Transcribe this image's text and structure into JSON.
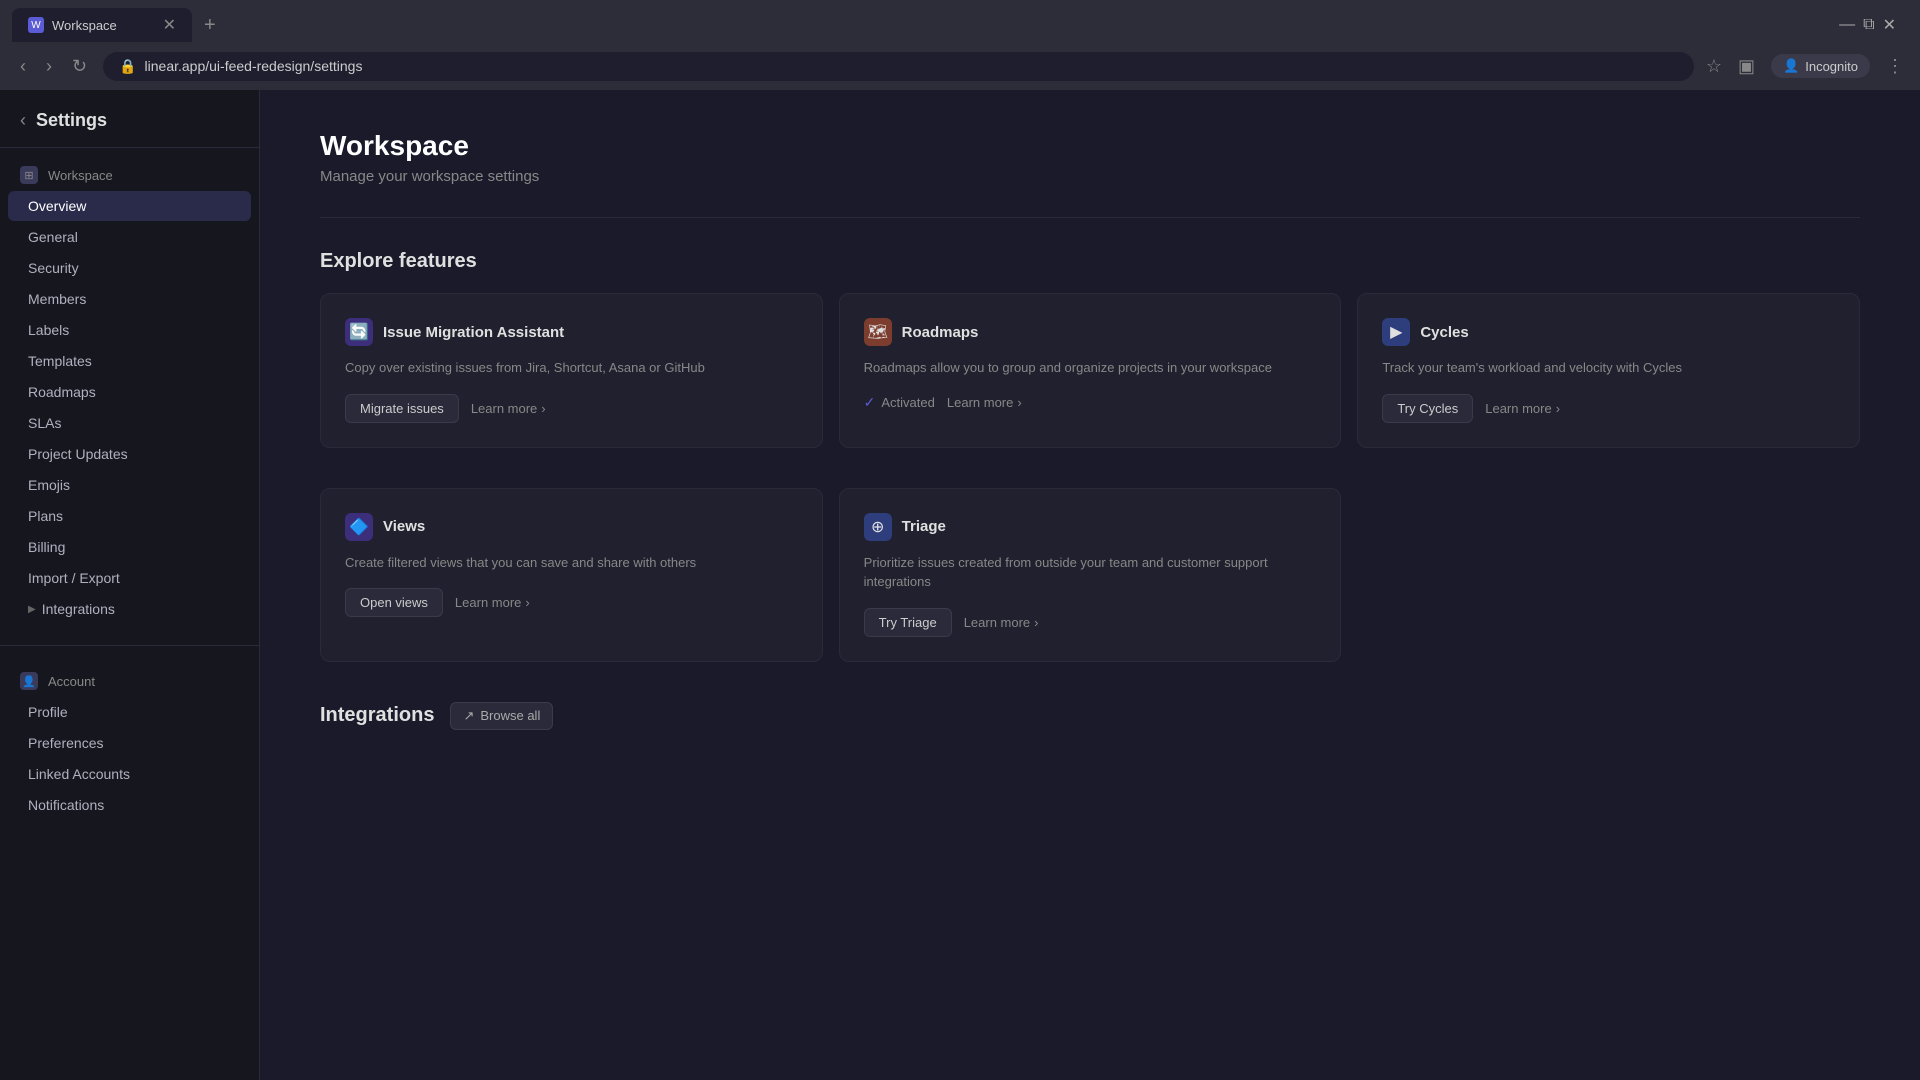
{
  "browser": {
    "tab_title": "Workspace",
    "tab_favicon": "W",
    "url": "linear.app/ui-feed-redesign/settings",
    "incognito_label": "Incognito"
  },
  "sidebar": {
    "title": "Settings",
    "back_label": "‹",
    "workspace_section": {
      "label": "Workspace",
      "items": [
        {
          "id": "overview",
          "label": "Overview",
          "active": true
        },
        {
          "id": "general",
          "label": "General",
          "active": false
        },
        {
          "id": "security",
          "label": "Security",
          "active": false
        },
        {
          "id": "members",
          "label": "Members",
          "active": false
        },
        {
          "id": "labels",
          "label": "Labels",
          "active": false
        },
        {
          "id": "templates",
          "label": "Templates",
          "active": false
        },
        {
          "id": "roadmaps",
          "label": "Roadmaps",
          "active": false
        },
        {
          "id": "slas",
          "label": "SLAs",
          "active": false
        },
        {
          "id": "project-updates",
          "label": "Project Updates",
          "active": false
        },
        {
          "id": "emojis",
          "label": "Emojis",
          "active": false
        },
        {
          "id": "plans",
          "label": "Plans",
          "active": false
        },
        {
          "id": "billing",
          "label": "Billing",
          "active": false
        },
        {
          "id": "import-export",
          "label": "Import / Export",
          "active": false
        },
        {
          "id": "integrations",
          "label": "Integrations",
          "active": false,
          "arrow": true
        }
      ]
    },
    "account_section": {
      "label": "Account",
      "items": [
        {
          "id": "profile",
          "label": "Profile",
          "active": false
        },
        {
          "id": "preferences",
          "label": "Preferences",
          "active": false
        },
        {
          "id": "linked-accounts",
          "label": "Linked Accounts",
          "active": false
        },
        {
          "id": "notifications",
          "label": "Notifications",
          "active": false
        }
      ]
    }
  },
  "page": {
    "title": "Workspace",
    "subtitle": "Manage your workspace settings",
    "explore_title": "Explore features",
    "integrations_title": "Integrations",
    "browse_all_label": "Browse all"
  },
  "features": [
    {
      "id": "issue-migration",
      "icon": "🔄",
      "icon_class": "purple",
      "name": "Issue Migration Assistant",
      "description": "Copy over existing issues from Jira, Shortcut, Asana or GitHub",
      "actions": [
        {
          "id": "migrate",
          "label": "Migrate issues",
          "type": "secondary"
        },
        {
          "id": "learn-more-migration",
          "label": "Learn more",
          "type": "link",
          "arrow": "›"
        }
      ]
    },
    {
      "id": "roadmaps",
      "icon": "🗺",
      "icon_class": "orange",
      "name": "Roadmaps",
      "description": "Roadmaps allow you to group and organize projects in your workspace",
      "actions": [
        {
          "id": "activated",
          "label": "Activated",
          "type": "activated"
        },
        {
          "id": "learn-more-roadmaps",
          "label": "Learn more",
          "type": "link",
          "arrow": "›"
        }
      ]
    },
    {
      "id": "cycles",
      "icon": "▶",
      "icon_class": "blue",
      "name": "Cycles",
      "description": "Track your team's workload and velocity with Cycles",
      "actions": [
        {
          "id": "try-cycles",
          "label": "Try Cycles",
          "type": "secondary"
        },
        {
          "id": "learn-more-cycles",
          "label": "Learn more",
          "type": "link",
          "arrow": "›"
        }
      ]
    },
    {
      "id": "views",
      "icon": "🔷",
      "icon_class": "purple",
      "name": "Views",
      "description": "Create filtered views that you can save and share with others",
      "actions": [
        {
          "id": "open-views",
          "label": "Open views",
          "type": "secondary"
        },
        {
          "id": "learn-more-views",
          "label": "Learn more",
          "type": "link",
          "arrow": "›"
        }
      ]
    },
    {
      "id": "triage",
      "icon": "⊕",
      "icon_class": "blue",
      "name": "Triage",
      "description": "Prioritize issues created from outside your team and customer support integrations",
      "actions": [
        {
          "id": "try-triage",
          "label": "Try Triage",
          "type": "secondary"
        },
        {
          "id": "learn-more-triage",
          "label": "Learn more",
          "type": "link",
          "arrow": "›"
        }
      ]
    }
  ]
}
